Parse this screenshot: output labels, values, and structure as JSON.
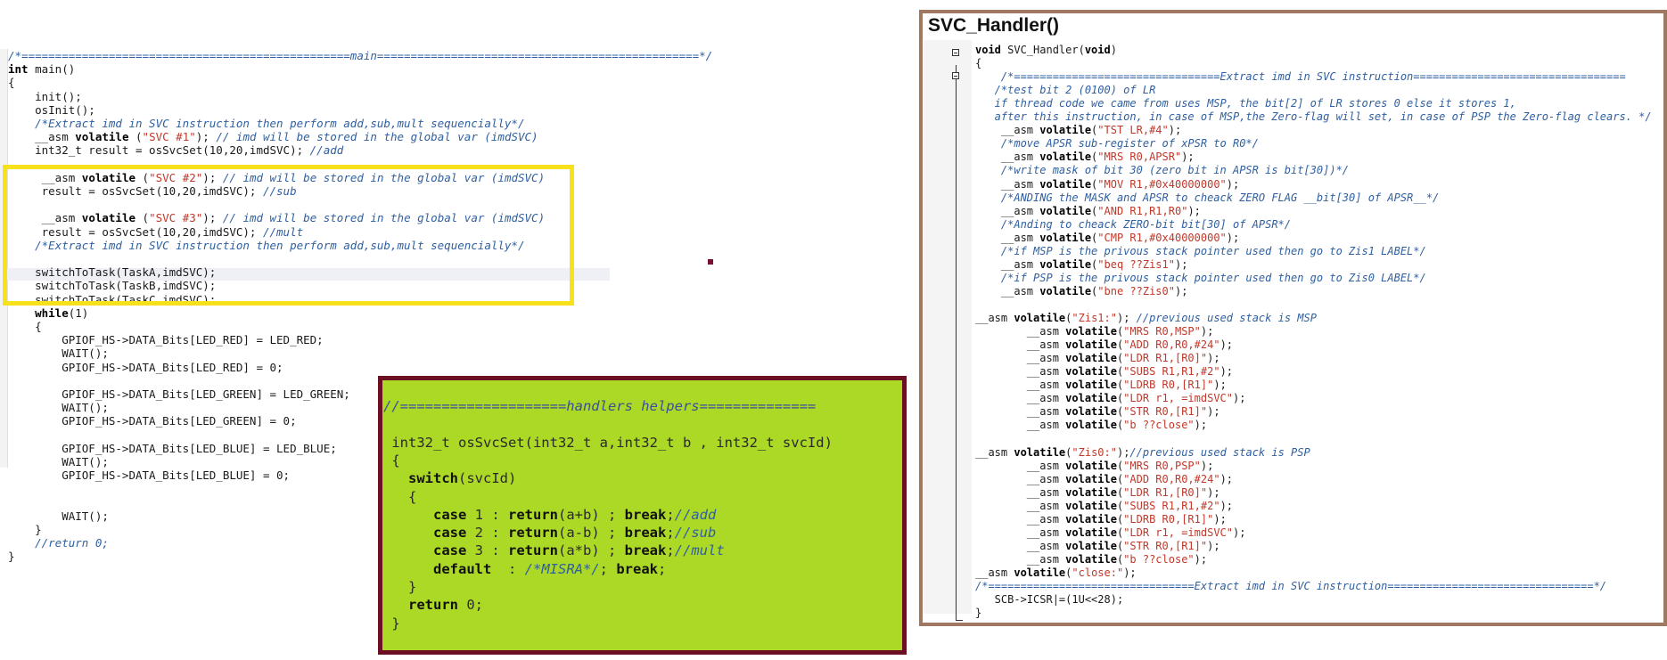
{
  "main_editor": {
    "lines": [
      {
        "text": "/*=================================================main================================================*/",
        "cls": "cm-blue"
      },
      {
        "text": "int main()",
        "cls": "kw"
      },
      {
        "text": "{",
        "cls": ""
      },
      {
        "text": "    init();",
        "cls": ""
      },
      {
        "text": "    osInit();",
        "cls": ""
      },
      {
        "text": "    /*Extract imd in SVC instruction then perform add,sub,mult sequencially*/",
        "cls": "cm-blue"
      },
      {
        "text": "    __asm volatile (\"SVC #1\"); // imd will be stored in the global var (imdSVC)",
        "cls": "asm"
      },
      {
        "text": "    int32_t result = osSvcSet(10,20,imdSVC); //add",
        "cls": "plaincm"
      },
      {
        "text": "",
        "cls": ""
      },
      {
        "text": "     __asm volatile (\"SVC #2\"); // imd will be stored in the global var (imdSVC)",
        "cls": "asm"
      },
      {
        "text": "     result = osSvcSet(10,20,imdSVC); //sub",
        "cls": "plaincm"
      },
      {
        "text": "",
        "cls": ""
      },
      {
        "text": "     __asm volatile (\"SVC #3\"); // imd will be stored in the global var (imdSVC)",
        "cls": "asm"
      },
      {
        "text": "     result = osSvcSet(10,20,imdSVC); //mult",
        "cls": "plaincm"
      },
      {
        "text": "    /*Extract imd in SVC instruction then perform add,sub,mult sequencially*/",
        "cls": "cm-blue"
      },
      {
        "text": "",
        "cls": ""
      },
      {
        "text": "    switchToTask(TaskA,imdSVC);",
        "cls": ""
      },
      {
        "text": "    switchToTask(TaskB,imdSVC);",
        "cls": ""
      },
      {
        "text": "    switchToTask(TaskC,imdSVC);",
        "cls": ""
      },
      {
        "text": "    while(1)",
        "cls": "kwfirst"
      },
      {
        "text": "    {",
        "cls": ""
      },
      {
        "text": "        GPIOF_HS->DATA_Bits[LED_RED] = LED_RED;",
        "cls": ""
      },
      {
        "text": "        WAIT();",
        "cls": ""
      },
      {
        "text": "        GPIOF_HS->DATA_Bits[LED_RED] = 0;",
        "cls": ""
      },
      {
        "text": "",
        "cls": ""
      },
      {
        "text": "        GPIOF_HS->DATA_Bits[LED_GREEN] = LED_GREEN;",
        "cls": ""
      },
      {
        "text": "        WAIT();",
        "cls": ""
      },
      {
        "text": "        GPIOF_HS->DATA_Bits[LED_GREEN] = 0;",
        "cls": ""
      },
      {
        "text": "",
        "cls": ""
      },
      {
        "text": "        GPIOF_HS->DATA_Bits[LED_BLUE] = LED_BLUE;",
        "cls": ""
      },
      {
        "text": "        WAIT();",
        "cls": ""
      },
      {
        "text": "        GPIOF_HS->DATA_Bits[LED_BLUE] = 0;",
        "cls": ""
      },
      {
        "text": "",
        "cls": ""
      },
      {
        "text": "",
        "cls": ""
      },
      {
        "text": "        WAIT();",
        "cls": ""
      },
      {
        "text": "    }",
        "cls": ""
      },
      {
        "text": "    //return 0;",
        "cls": "cm-blue"
      },
      {
        "text": "}",
        "cls": ""
      }
    ]
  },
  "helpers": {
    "lines": [
      {
        "text": "//====================handlers helpers==============",
        "cls": "cm"
      },
      {
        "text": "",
        "cls": ""
      },
      {
        "text": " int32_t osSvcSet(int32_t a,int32_t b , int32_t svcId)",
        "cls": ""
      },
      {
        "text": " {",
        "cls": ""
      },
      {
        "text": "   switch(svcId)",
        "cls": "kwfirst"
      },
      {
        "text": "   {",
        "cls": ""
      },
      {
        "text": "      case 1 : return(a+b) ; break;//add",
        "cls": "case"
      },
      {
        "text": "      case 2 : return(a-b) ; break;//sub",
        "cls": "case"
      },
      {
        "text": "      case 3 : return(a*b) ; break;//mult",
        "cls": "case"
      },
      {
        "text": "      default  : /*MISRA*/; break;",
        "cls": "case"
      },
      {
        "text": "   }",
        "cls": ""
      },
      {
        "text": "   return 0;",
        "cls": "kwfirst"
      },
      {
        "text": " }",
        "cls": ""
      }
    ]
  },
  "svc_handler": {
    "title": "SVC_Handler()",
    "lines": [
      {
        "text": "void SVC_Handler(void)",
        "cls": "kwfirst"
      },
      {
        "text": "{",
        "cls": ""
      },
      {
        "text": "    /*================================Extract imd in SVC instruction=================================",
        "cls": "cm-blue"
      },
      {
        "text": "   /*test bit 2 (0100) of LR",
        "cls": "cm-blue"
      },
      {
        "text": "   if thread code we came from uses MSP, the bit[2] of LR stores 0 else it stores 1,",
        "cls": "cm-blue"
      },
      {
        "text": "   after this instruction, in case of MSP,the Zero-flag will set, in case of PSP the Zero-flag clears. */",
        "cls": "cm-blue"
      },
      {
        "text": "    __asm volatile(\"TST LR,#4\");",
        "cls": "asm"
      },
      {
        "text": "    /*move APSR sub-register of xPSR to R0*/",
        "cls": "cm-blue"
      },
      {
        "text": "    __asm volatile(\"MRS R0,APSR\");",
        "cls": "asm"
      },
      {
        "text": "    /*write mask of bit 30 (zero bit in APSR is bit[30])*/",
        "cls": "cm-blue"
      },
      {
        "text": "    __asm volatile(\"MOV R1,#0x40000000\");",
        "cls": "asm"
      },
      {
        "text": "    /*ANDING the MASK and APSR to cheack ZERO FLAG __bit[30] of APSR__*/",
        "cls": "cm-blue"
      },
      {
        "text": "    __asm volatile(\"AND R1,R1,R0\");",
        "cls": "asm"
      },
      {
        "text": "    /*Anding to cheack ZERO-bit bit[30] of APSR*/",
        "cls": "cm-blue"
      },
      {
        "text": "    __asm volatile(\"CMP R1,#0x40000000\");",
        "cls": "asm"
      },
      {
        "text": "    /*if MSP is the privous stack pointer used then go to Zis1 LABEL*/",
        "cls": "cm-blue"
      },
      {
        "text": "    __asm volatile(\"beq ??Zis1\");",
        "cls": "asm"
      },
      {
        "text": "    /*if PSP is the privous stack pointer used then go to Zis0 LABEL*/",
        "cls": "cm-blue"
      },
      {
        "text": "    __asm volatile(\"bne ??Zis0\");",
        "cls": "asm"
      },
      {
        "text": "",
        "cls": ""
      },
      {
        "text": "__asm volatile(\"Zis1:\"); //previous used stack is MSP",
        "cls": "asm"
      },
      {
        "text": "        __asm volatile(\"MRS R0,MSP\");",
        "cls": "asm"
      },
      {
        "text": "        __asm volatile(\"ADD R0,R0,#24\");",
        "cls": "asm"
      },
      {
        "text": "        __asm volatile(\"LDR R1,[R0]\");",
        "cls": "asm"
      },
      {
        "text": "        __asm volatile(\"SUBS R1,R1,#2\");",
        "cls": "asm"
      },
      {
        "text": "        __asm volatile(\"LDRB R0,[R1]\");",
        "cls": "asm"
      },
      {
        "text": "        __asm volatile(\"LDR r1, =imdSVC\");",
        "cls": "asm"
      },
      {
        "text": "        __asm volatile(\"STR R0,[R1]\");",
        "cls": "asm"
      },
      {
        "text": "        __asm volatile(\"b ??close\");",
        "cls": "asm"
      },
      {
        "text": "",
        "cls": ""
      },
      {
        "text": "__asm volatile(\"Zis0:\");//previous used stack is PSP",
        "cls": "asm"
      },
      {
        "text": "        __asm volatile(\"MRS R0,PSP\");",
        "cls": "asm"
      },
      {
        "text": "        __asm volatile(\"ADD R0,R0,#24\");",
        "cls": "asm"
      },
      {
        "text": "        __asm volatile(\"LDR R1,[R0]\");",
        "cls": "asm"
      },
      {
        "text": "        __asm volatile(\"SUBS R1,R1,#2\");",
        "cls": "asm"
      },
      {
        "text": "        __asm volatile(\"LDRB R0,[R1]\");",
        "cls": "asm"
      },
      {
        "text": "        __asm volatile(\"LDR r1, =imdSVC\");",
        "cls": "asm"
      },
      {
        "text": "        __asm volatile(\"STR R0,[R1]\");",
        "cls": "asm"
      },
      {
        "text": "        __asm volatile(\"b ??close\");",
        "cls": "asm"
      },
      {
        "text": "__asm volatile(\"close:\");",
        "cls": "asm"
      },
      {
        "text": "/*================================Extract imd in SVC instruction================================*/",
        "cls": "cm-blue"
      },
      {
        "text": "   SCB->ICSR|=(1U<<28);",
        "cls": ""
      },
      {
        "text": "}",
        "cls": ""
      }
    ]
  }
}
